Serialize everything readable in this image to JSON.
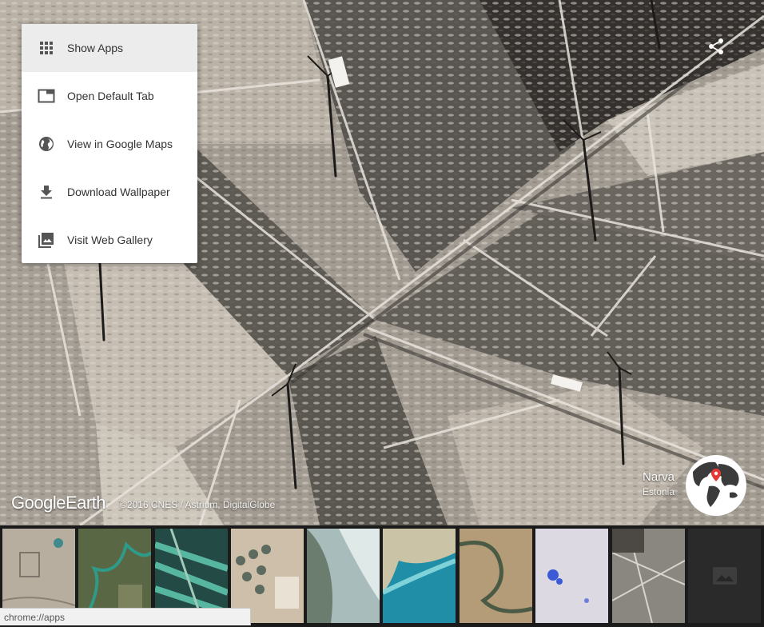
{
  "menu": {
    "items": [
      {
        "label": "Show Apps",
        "icon": "apps-grid-icon"
      },
      {
        "label": "Open Default Tab",
        "icon": "tab-icon"
      },
      {
        "label": "View in Google Maps",
        "icon": "globe-icon"
      },
      {
        "label": "Download Wallpaper",
        "icon": "download-icon"
      },
      {
        "label": "Visit Web Gallery",
        "icon": "gallery-icon"
      }
    ]
  },
  "branding": {
    "logo_google": "Google",
    "logo_earth": "Earth",
    "attribution": "©2016 CNES / Astrium, DigitalGlobe"
  },
  "location": {
    "city": "Narva",
    "country": "Estonia"
  },
  "thumbnails": [
    {
      "color": "#b9b1a2"
    },
    {
      "color": "#5d6a45"
    },
    {
      "color": "#3d6b5a"
    },
    {
      "color": "#c7b8a4"
    },
    {
      "color": "#8fa4a6"
    },
    {
      "color": "#2e9bb2"
    },
    {
      "color": "#a58f6e"
    },
    {
      "color": "#d9d6e0"
    },
    {
      "color": "#8a8781"
    },
    {
      "color": "#2a2a2a",
      "icon": "image-placeholder-icon"
    }
  ],
  "status_bar": {
    "url": "chrome://apps"
  },
  "colors": {
    "menu_active_bg": "#ececec",
    "menu_text": "#333333",
    "pin": "#e53935"
  }
}
